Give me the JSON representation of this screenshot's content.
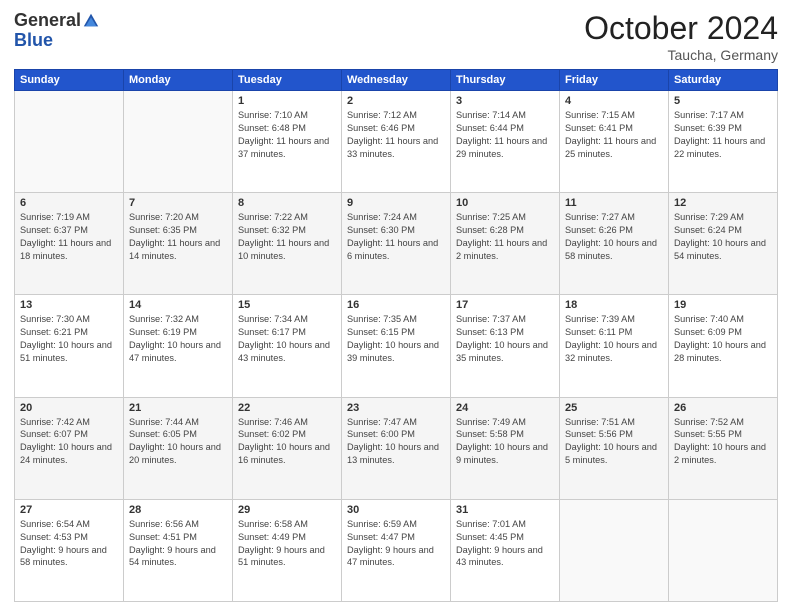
{
  "header": {
    "logo_general": "General",
    "logo_blue": "Blue",
    "month_title": "October 2024",
    "location": "Taucha, Germany"
  },
  "weekdays": [
    "Sunday",
    "Monday",
    "Tuesday",
    "Wednesday",
    "Thursday",
    "Friday",
    "Saturday"
  ],
  "weeks": [
    [
      {
        "day": "",
        "info": ""
      },
      {
        "day": "",
        "info": ""
      },
      {
        "day": "1",
        "info": "Sunrise: 7:10 AM\nSunset: 6:48 PM\nDaylight: 11 hours and 37 minutes."
      },
      {
        "day": "2",
        "info": "Sunrise: 7:12 AM\nSunset: 6:46 PM\nDaylight: 11 hours and 33 minutes."
      },
      {
        "day": "3",
        "info": "Sunrise: 7:14 AM\nSunset: 6:44 PM\nDaylight: 11 hours and 29 minutes."
      },
      {
        "day": "4",
        "info": "Sunrise: 7:15 AM\nSunset: 6:41 PM\nDaylight: 11 hours and 25 minutes."
      },
      {
        "day": "5",
        "info": "Sunrise: 7:17 AM\nSunset: 6:39 PM\nDaylight: 11 hours and 22 minutes."
      }
    ],
    [
      {
        "day": "6",
        "info": "Sunrise: 7:19 AM\nSunset: 6:37 PM\nDaylight: 11 hours and 18 minutes."
      },
      {
        "day": "7",
        "info": "Sunrise: 7:20 AM\nSunset: 6:35 PM\nDaylight: 11 hours and 14 minutes."
      },
      {
        "day": "8",
        "info": "Sunrise: 7:22 AM\nSunset: 6:32 PM\nDaylight: 11 hours and 10 minutes."
      },
      {
        "day": "9",
        "info": "Sunrise: 7:24 AM\nSunset: 6:30 PM\nDaylight: 11 hours and 6 minutes."
      },
      {
        "day": "10",
        "info": "Sunrise: 7:25 AM\nSunset: 6:28 PM\nDaylight: 11 hours and 2 minutes."
      },
      {
        "day": "11",
        "info": "Sunrise: 7:27 AM\nSunset: 6:26 PM\nDaylight: 10 hours and 58 minutes."
      },
      {
        "day": "12",
        "info": "Sunrise: 7:29 AM\nSunset: 6:24 PM\nDaylight: 10 hours and 54 minutes."
      }
    ],
    [
      {
        "day": "13",
        "info": "Sunrise: 7:30 AM\nSunset: 6:21 PM\nDaylight: 10 hours and 51 minutes."
      },
      {
        "day": "14",
        "info": "Sunrise: 7:32 AM\nSunset: 6:19 PM\nDaylight: 10 hours and 47 minutes."
      },
      {
        "day": "15",
        "info": "Sunrise: 7:34 AM\nSunset: 6:17 PM\nDaylight: 10 hours and 43 minutes."
      },
      {
        "day": "16",
        "info": "Sunrise: 7:35 AM\nSunset: 6:15 PM\nDaylight: 10 hours and 39 minutes."
      },
      {
        "day": "17",
        "info": "Sunrise: 7:37 AM\nSunset: 6:13 PM\nDaylight: 10 hours and 35 minutes."
      },
      {
        "day": "18",
        "info": "Sunrise: 7:39 AM\nSunset: 6:11 PM\nDaylight: 10 hours and 32 minutes."
      },
      {
        "day": "19",
        "info": "Sunrise: 7:40 AM\nSunset: 6:09 PM\nDaylight: 10 hours and 28 minutes."
      }
    ],
    [
      {
        "day": "20",
        "info": "Sunrise: 7:42 AM\nSunset: 6:07 PM\nDaylight: 10 hours and 24 minutes."
      },
      {
        "day": "21",
        "info": "Sunrise: 7:44 AM\nSunset: 6:05 PM\nDaylight: 10 hours and 20 minutes."
      },
      {
        "day": "22",
        "info": "Sunrise: 7:46 AM\nSunset: 6:02 PM\nDaylight: 10 hours and 16 minutes."
      },
      {
        "day": "23",
        "info": "Sunrise: 7:47 AM\nSunset: 6:00 PM\nDaylight: 10 hours and 13 minutes."
      },
      {
        "day": "24",
        "info": "Sunrise: 7:49 AM\nSunset: 5:58 PM\nDaylight: 10 hours and 9 minutes."
      },
      {
        "day": "25",
        "info": "Sunrise: 7:51 AM\nSunset: 5:56 PM\nDaylight: 10 hours and 5 minutes."
      },
      {
        "day": "26",
        "info": "Sunrise: 7:52 AM\nSunset: 5:55 PM\nDaylight: 10 hours and 2 minutes."
      }
    ],
    [
      {
        "day": "27",
        "info": "Sunrise: 6:54 AM\nSunset: 4:53 PM\nDaylight: 9 hours and 58 minutes."
      },
      {
        "day": "28",
        "info": "Sunrise: 6:56 AM\nSunset: 4:51 PM\nDaylight: 9 hours and 54 minutes."
      },
      {
        "day": "29",
        "info": "Sunrise: 6:58 AM\nSunset: 4:49 PM\nDaylight: 9 hours and 51 minutes."
      },
      {
        "day": "30",
        "info": "Sunrise: 6:59 AM\nSunset: 4:47 PM\nDaylight: 9 hours and 47 minutes."
      },
      {
        "day": "31",
        "info": "Sunrise: 7:01 AM\nSunset: 4:45 PM\nDaylight: 9 hours and 43 minutes."
      },
      {
        "day": "",
        "info": ""
      },
      {
        "day": "",
        "info": ""
      }
    ]
  ]
}
